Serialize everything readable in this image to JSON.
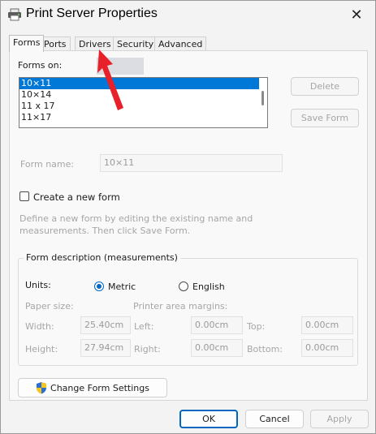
{
  "window": {
    "title": "Print Server Properties",
    "close_glyph": "✕"
  },
  "tabs": [
    {
      "label": "Forms",
      "active": true
    },
    {
      "label": "Ports",
      "active": false
    },
    {
      "label": "Drivers",
      "active": false
    },
    {
      "label": "Security",
      "active": false
    },
    {
      "label": "Advanced",
      "active": false
    }
  ],
  "forms": {
    "forms_on_label": "Forms on:",
    "list": [
      "10×11",
      "10×14",
      "11 x 17",
      "11×17"
    ],
    "selected_index": 0,
    "delete_label": "Delete",
    "save_form_label": "Save Form",
    "form_name_label": "Form name:",
    "form_name_value": "10×11",
    "create_new_label": "Create a new form",
    "create_new_checked": false,
    "help_line1": "Define a new form by editing the existing name and",
    "help_line2": "measurements. Then click Save Form."
  },
  "description": {
    "title": "Form description (measurements)",
    "units_label": "Units:",
    "metric_label": "Metric",
    "english_label": "English",
    "selected_unit": "Metric",
    "paper_size_label": "Paper size:",
    "margins_label": "Printer area margins:",
    "width_label": "Width:",
    "width_value": "25.40cm",
    "height_label": "Height:",
    "height_value": "27.94cm",
    "left_label": "Left:",
    "left_value": "0.00cm",
    "right_label": "Right:",
    "right_value": "0.00cm",
    "top_label": "Top:",
    "top_value": "0.00cm",
    "bottom_label": "Bottom:",
    "bottom_value": "0.00cm"
  },
  "change_settings_label": "Change Form Settings",
  "footer": {
    "ok_label": "OK",
    "cancel_label": "Cancel",
    "apply_label": "Apply"
  },
  "colors": {
    "accent": "#0067c0",
    "selection": "#0078d7",
    "annotation_arrow": "#e8202a"
  }
}
